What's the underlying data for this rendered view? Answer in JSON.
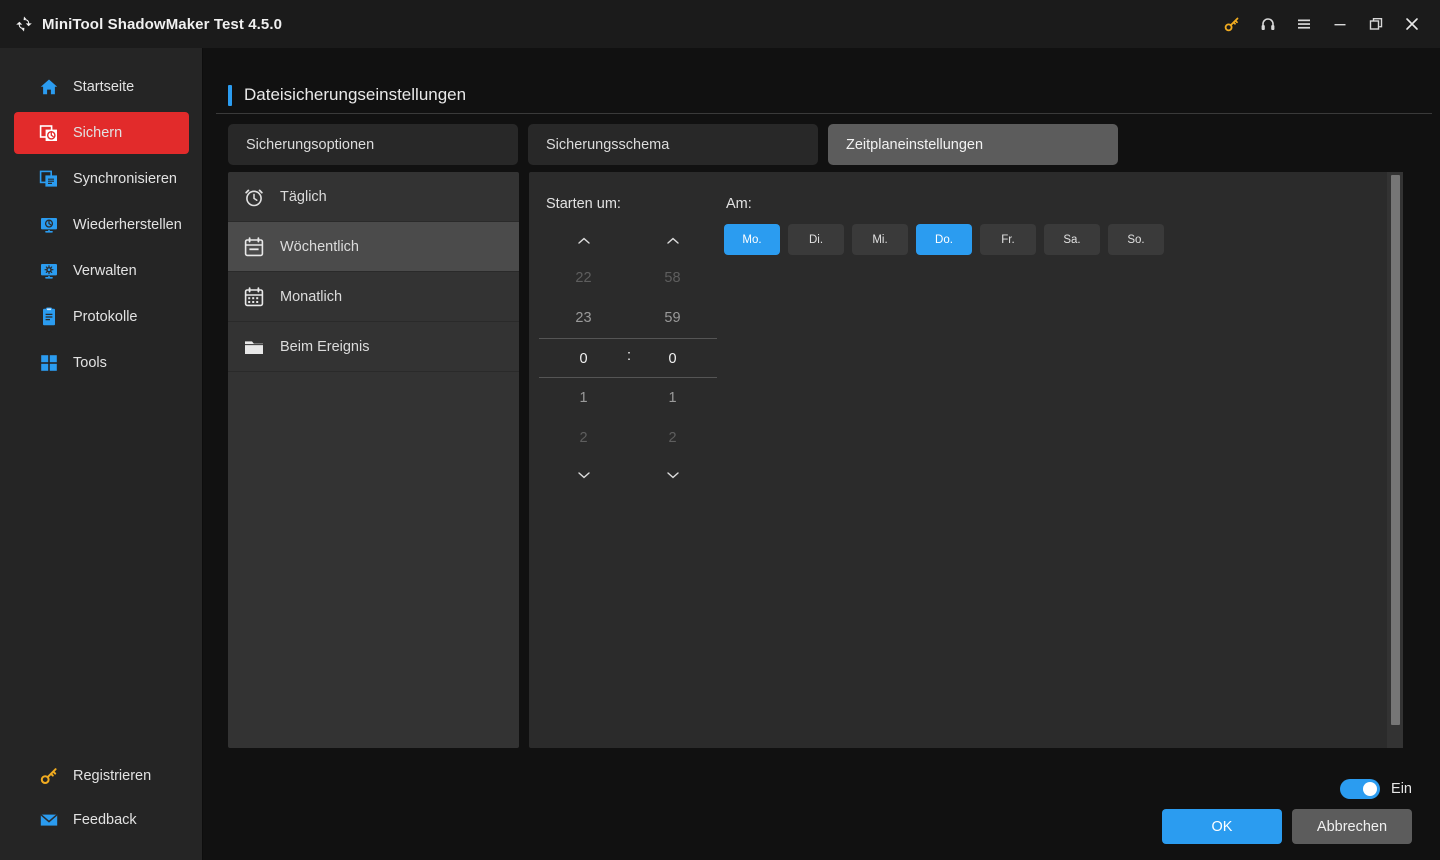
{
  "window": {
    "title": "MiniTool ShadowMaker Test 4.5.0",
    "logo_icon": "shadowmaker-logo-icon",
    "controls": [
      {
        "name": "key-icon",
        "label": ""
      },
      {
        "name": "headset-icon",
        "label": ""
      },
      {
        "name": "menu-icon",
        "label": ""
      },
      {
        "name": "minimize-icon",
        "label": ""
      },
      {
        "name": "restore-icon",
        "label": ""
      },
      {
        "name": "close-icon",
        "label": ""
      }
    ]
  },
  "sidebar": {
    "items": [
      {
        "label": "Startseite",
        "icon": "home-icon",
        "active": false
      },
      {
        "label": "Sichern",
        "icon": "backup-icon",
        "active": true
      },
      {
        "label": "Synchronisieren",
        "icon": "sync-icon",
        "active": false
      },
      {
        "label": "Wiederherstellen",
        "icon": "restore-disk-icon",
        "active": false
      },
      {
        "label": "Verwalten",
        "icon": "manage-icon",
        "active": false
      },
      {
        "label": "Protokolle",
        "icon": "logs-icon",
        "active": false
      },
      {
        "label": "Tools",
        "icon": "tools-icon",
        "active": false
      }
    ],
    "bottom_items": [
      {
        "label": "Registrieren",
        "icon": "key-icon"
      },
      {
        "label": "Feedback",
        "icon": "mail-icon"
      }
    ],
    "active_color": "#e22b2b"
  },
  "page": {
    "title": "Dateisicherungseinstellungen",
    "accent_color": "#2b9cf0"
  },
  "tabs": [
    {
      "label": "Sicherungsoptionen",
      "active": false
    },
    {
      "label": "Sicherungsschema",
      "active": false
    },
    {
      "label": "Zeitplaneinstellungen",
      "active": true
    }
  ],
  "schedule_list": [
    {
      "label": "Täglich",
      "icon": "alarm-clock-icon",
      "selected": false
    },
    {
      "label": "Wöchentlich",
      "icon": "calendar-icon",
      "selected": true
    },
    {
      "label": "Monatlich",
      "icon": "calendar-month-icon",
      "selected": false
    },
    {
      "label": "Beim Ereignis",
      "icon": "folder-icon",
      "selected": false
    }
  ],
  "detail": {
    "start_label": "Starten um:",
    "on_label": "Am:",
    "hour": {
      "above2": "22",
      "above1": "23",
      "selected": "0",
      "below1": "1",
      "below2": "2",
      "up_icon": "chevron-up-icon",
      "down_icon": "chevron-down-icon"
    },
    "separator": ":",
    "minute": {
      "above2": "58",
      "above1": "59",
      "selected": "0",
      "below1": "1",
      "below2": "2",
      "up_icon": "chevron-up-icon",
      "down_icon": "chevron-down-icon"
    },
    "weekdays": [
      {
        "label": "Mo.",
        "selected": true
      },
      {
        "label": "Di.",
        "selected": false
      },
      {
        "label": "Mi.",
        "selected": false
      },
      {
        "label": "Do.",
        "selected": true
      },
      {
        "label": "Fr.",
        "selected": false
      },
      {
        "label": "Sa.",
        "selected": false
      },
      {
        "label": "So.",
        "selected": false
      }
    ],
    "selected_color": "#2b9cf0"
  },
  "footer": {
    "toggle_label": "Ein",
    "toggle_on": true,
    "ok_label": "OK",
    "cancel_label": "Abbrechen"
  }
}
